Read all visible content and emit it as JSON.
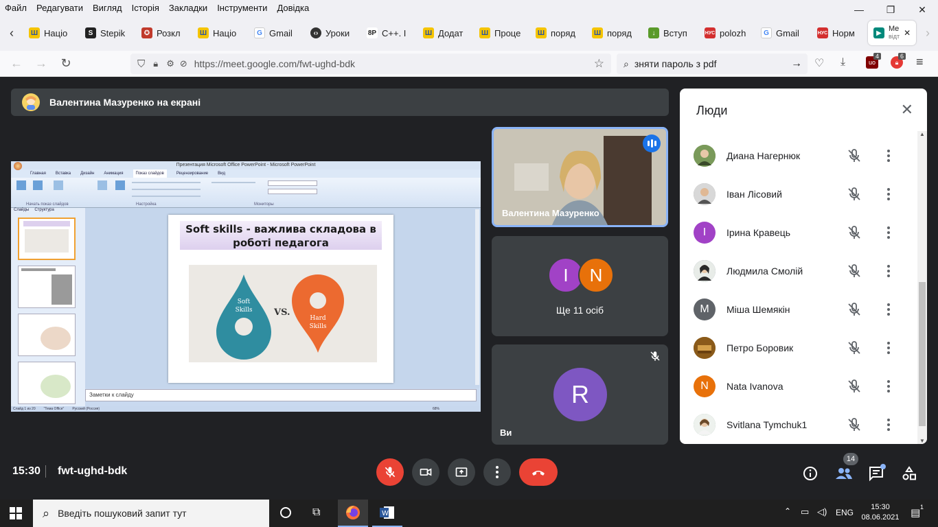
{
  "menubar": {
    "items": [
      "Файл",
      "Редагувати",
      "Вигляд",
      "Історія",
      "Закладки",
      "Інструменти",
      "Довідка"
    ]
  },
  "tabs": [
    {
      "label": "Націо",
      "icon": "trident-icon"
    },
    {
      "label": "Stepik",
      "icon": "stepik-icon"
    },
    {
      "label": "Розкл",
      "icon": "schedule-icon"
    },
    {
      "label": "Націо",
      "icon": "trident-icon"
    },
    {
      "label": "Gmail",
      "icon": "google-icon"
    },
    {
      "label": "Уроки",
      "icon": "code-icon"
    },
    {
      "label": "C++. I",
      "icon": "cpp-icon"
    },
    {
      "label": "Додат",
      "icon": "trident-icon"
    },
    {
      "label": "Проце",
      "icon": "trident-icon"
    },
    {
      "label": "поряд",
      "icon": "trident-icon"
    },
    {
      "label": "поряд",
      "icon": "trident-icon"
    },
    {
      "label": "Вступ",
      "icon": "download-icon"
    },
    {
      "label": "polozh",
      "icon": "nus-icon"
    },
    {
      "label": "Gmail",
      "icon": "google-icon"
    },
    {
      "label": "Норм",
      "icon": "nus-icon"
    }
  ],
  "active_tab": {
    "label_line1": "Me",
    "label_line2": "відт"
  },
  "navbar": {
    "url": "https://meet.google.com/fwt-ughd-bdk",
    "search_value": "зняти пароль з pdf",
    "badge_ublock": "4",
    "badge_shield": "6"
  },
  "meet": {
    "banner_text": "Валентина Мазуренко на екрані",
    "presenter_tile_name": "Валентина Мазуренко",
    "others_tile_label": "Ще 11 осіб",
    "others_avatars": [
      {
        "letter": "I",
        "color": "#a142c6"
      },
      {
        "letter": "N",
        "color": "#e8710a"
      }
    ],
    "self_tile_name": "Ви",
    "self_avatar_letter": "R",
    "meeting_time": "15:30",
    "meeting_code": "fwt-ughd-bdk",
    "participants_badge": "14"
  },
  "ppt": {
    "window_title": "Презентация Microsoft Office PowerPoint - Microsoft PowerPoint",
    "ribbon_tabs": [
      "Главная",
      "Вставка",
      "Дизайн",
      "Анимация",
      "Показ слайдов",
      "Рецензирование",
      "Вид"
    ],
    "active_ribbon_tab": "Показ слайдов",
    "left_tabs": [
      "Слайды",
      "Структура"
    ],
    "slide_title": "Soft skills - важлива складова в роботі педагога",
    "drop_left_label": "Soft Skills",
    "vs_label": "VS.",
    "drop_right_label": "Hard Skills",
    "notes_placeholder": "Заметки к слайду",
    "status_slide": "Слайд 1 из 20",
    "status_theme": "\"Тема Office\"",
    "status_lang": "Русский (Россия)",
    "status_zoom": "68%",
    "ribbon_group_1": "Начать показ слайдов",
    "ribbon_group_2": "Настройка",
    "ribbon_group_3": "Мониторы"
  },
  "people": {
    "title": "Люди",
    "list": [
      {
        "name": "Диана Нагернюк",
        "avatar": "",
        "color": "#6b8e5a"
      },
      {
        "name": "Іван Лісовий",
        "avatar": "",
        "color": "#8a8a8a"
      },
      {
        "name": "Ірина Кравець",
        "avatar": "I",
        "color": "#a142c6"
      },
      {
        "name": "Людмила Смолій",
        "avatar": "",
        "color": "#5a6b7a"
      },
      {
        "name": "Міша Шемякін",
        "avatar": "M",
        "color": "#5f6368"
      },
      {
        "name": "Петро Боровик",
        "avatar": "",
        "color": "#a0732a"
      },
      {
        "name": "Nata Ivanova",
        "avatar": "N",
        "color": "#e8710a"
      },
      {
        "name": "Svitlana Tymchuk1",
        "avatar": "",
        "color": "#7a9a8a"
      }
    ]
  },
  "taskbar": {
    "search_placeholder": "Введіть пошуковий запит тут",
    "lang": "ENG",
    "time": "15:30",
    "date": "08.06.2021",
    "notif_count": "1"
  },
  "colors": {
    "meet_bg": "#202124",
    "tile_bg": "#3c4043",
    "hangup": "#ea4335",
    "accent_blue": "#1a73e8"
  }
}
